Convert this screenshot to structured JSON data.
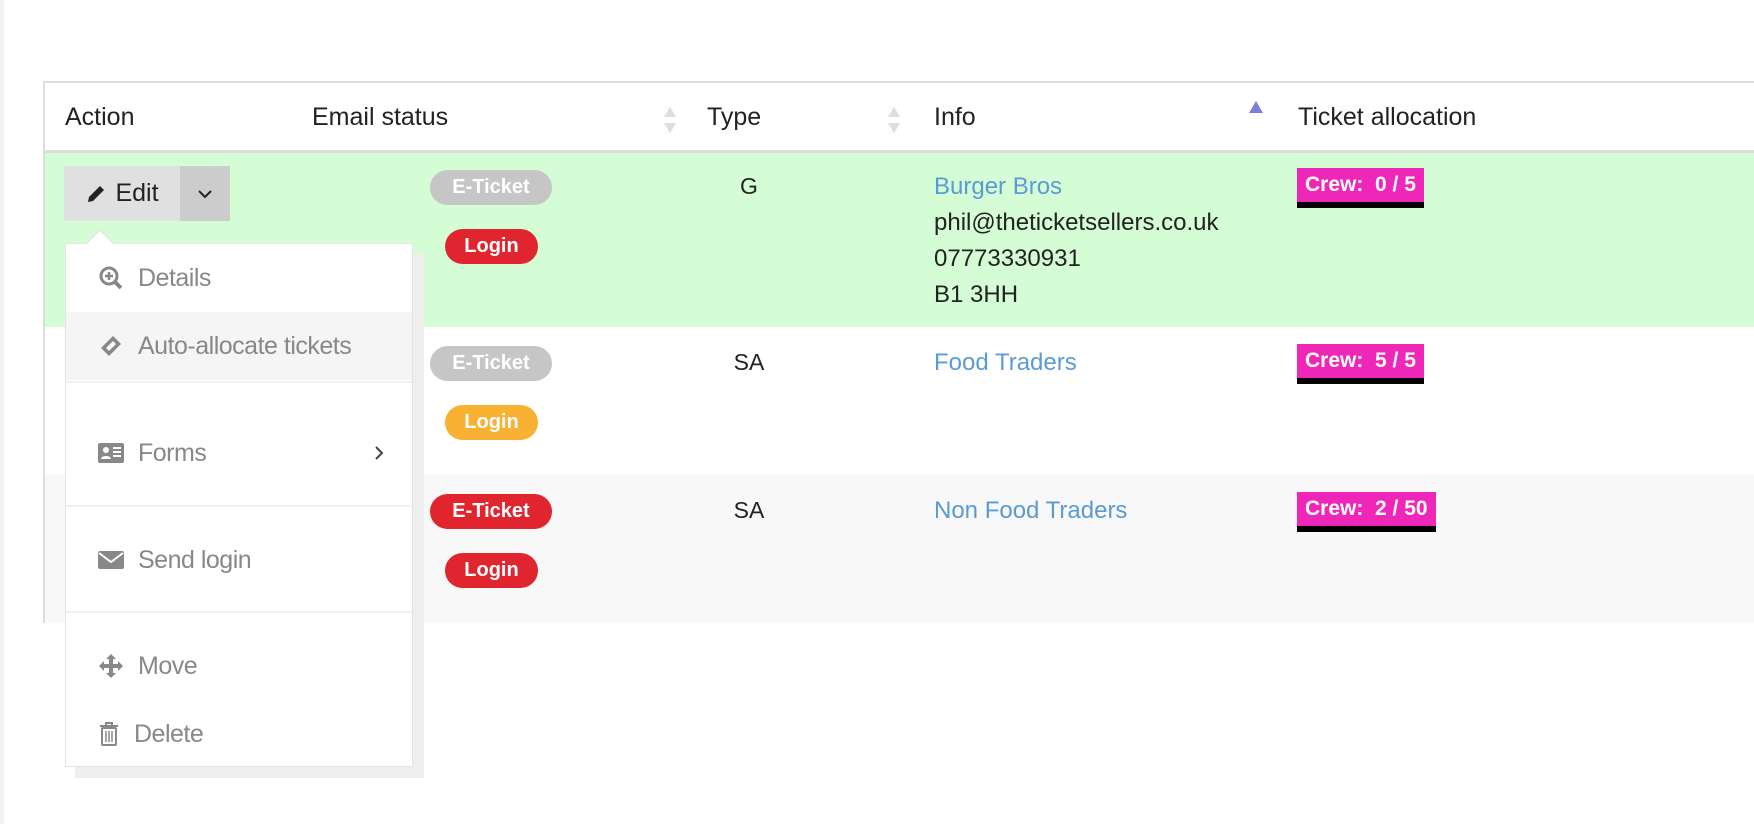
{
  "table": {
    "headers": [
      {
        "label": "Action"
      },
      {
        "label": "Email status"
      },
      {
        "label": "Type"
      },
      {
        "label": "Info"
      },
      {
        "label": "Ticket allocation"
      }
    ],
    "sort": {
      "column": "Info",
      "direction": "ascending",
      "active_color": "#7b7fd9"
    },
    "rows": [
      {
        "email_badge": {
          "label": "E-Ticket",
          "color": "#c6c6c6"
        },
        "login_badge": {
          "label": "Login",
          "color": "#e0252e"
        },
        "type": "G",
        "info": {
          "name": "Burger Bros",
          "email": "phil@theticketsellers.co.uk",
          "phone": "07773330931",
          "postcode": "B1 3HH"
        },
        "allocation": "Crew:  0 / 5",
        "highlight": "#d5fdd5"
      },
      {
        "email_badge": {
          "label": "E-Ticket",
          "color": "#c6c6c6"
        },
        "login_badge": {
          "label": "Login",
          "color": "#f8b133"
        },
        "type": "SA",
        "info": {
          "name": "Food Traders"
        },
        "allocation": "Crew:  5 / 5"
      },
      {
        "email_badge": {
          "label": "E-Ticket",
          "color": "#e0252e"
        },
        "login_badge": {
          "label": "Login",
          "color": "#e0252e"
        },
        "type": "SA",
        "info": {
          "name": "Non Food Traders"
        },
        "allocation": "Crew:  2 / 50",
        "background": "#f8f8f8"
      }
    ]
  },
  "action": {
    "edit_label": "Edit"
  },
  "menu": {
    "items": [
      {
        "label": "Details",
        "icon": "zoom-in-icon"
      },
      {
        "label": "Auto-allocate tickets",
        "icon": "ticket-icon",
        "hovered": true
      },
      {
        "label": "Forms",
        "icon": "id-card-icon",
        "submenu": true
      },
      {
        "label": "Send login",
        "icon": "envelope-icon"
      },
      {
        "label": "Move",
        "icon": "move-icon"
      },
      {
        "label": "Delete",
        "icon": "trash-icon"
      }
    ]
  }
}
